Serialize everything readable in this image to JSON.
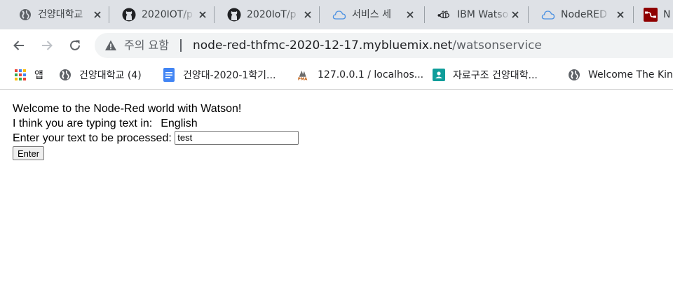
{
  "tabs": [
    {
      "title": "건양대학교",
      "icon": "globe-icon"
    },
    {
      "title": "2020IOT/p",
      "icon": "github-icon"
    },
    {
      "title": "2020IoT/p",
      "icon": "github-icon"
    },
    {
      "title": "서비스 세",
      "icon": "cloud-icon"
    },
    {
      "title": "IBM Watso",
      "icon": "watson-bee-icon"
    },
    {
      "title": "NodeRED",
      "icon": "cloud-icon"
    },
    {
      "title": "N",
      "icon": "nodered-icon"
    }
  ],
  "toolbar": {
    "security_label": "주의 요함",
    "url_host": "node-red-thfmc-2020-12-17.mybluemix.net",
    "url_path": "/watsonservice"
  },
  "bookmarks": [
    {
      "label": "앱",
      "icon": "apps-grid-icon"
    },
    {
      "label": "건양대학교 (4)",
      "icon": "globe-icon"
    },
    {
      "label": "건양대-2020-1학기...",
      "icon": "google-docs-icon"
    },
    {
      "label": "127.0.0.1 / localhos...",
      "icon": "phpmyadmin-icon"
    },
    {
      "label": "자료구조 건양대학...",
      "icon": "classroom-icon"
    },
    {
      "label": "Welcome The Kin",
      "icon": "globe-icon"
    }
  ],
  "page": {
    "welcome": "Welcome to the Node-Red world with Watson!",
    "language_prompt": "I think you are typing text in:",
    "language_value": "English",
    "input_label": "Enter your text to be processed:",
    "input_value": "test",
    "submit_label": "Enter"
  },
  "colors": {
    "tab_strip": "#dee1e6",
    "omnibox": "#f1f3f4",
    "bookmark_doc_blue": "#4285f4",
    "classroom_teal": "#0f9d9a"
  }
}
